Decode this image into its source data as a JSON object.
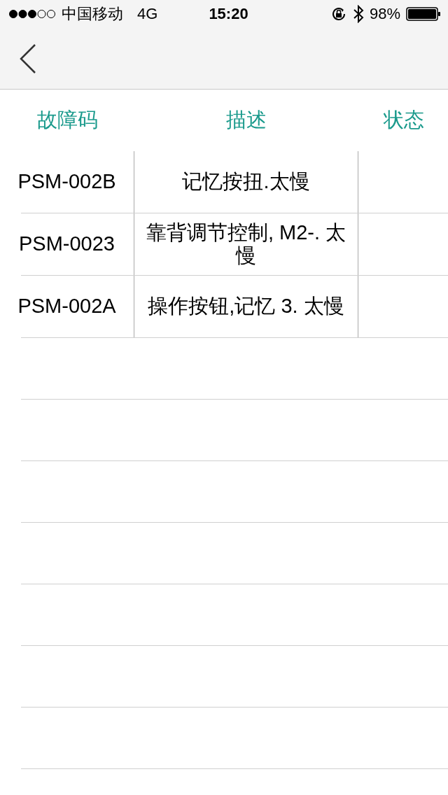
{
  "status_bar": {
    "carrier": "中国移动",
    "network": "4G",
    "time": "15:20",
    "battery": "98%"
  },
  "table": {
    "columns": [
      "故障码",
      "描述",
      "状态"
    ],
    "rows": [
      {
        "code": "PSM-002B",
        "description": "记忆按扭.太慢"
      },
      {
        "code": "PSM-0023",
        "description": "靠背调节控制, M2-. 太慢"
      },
      {
        "code": "PSM-002A",
        "description": "操作按钮,记忆 3. 太慢"
      }
    ]
  }
}
